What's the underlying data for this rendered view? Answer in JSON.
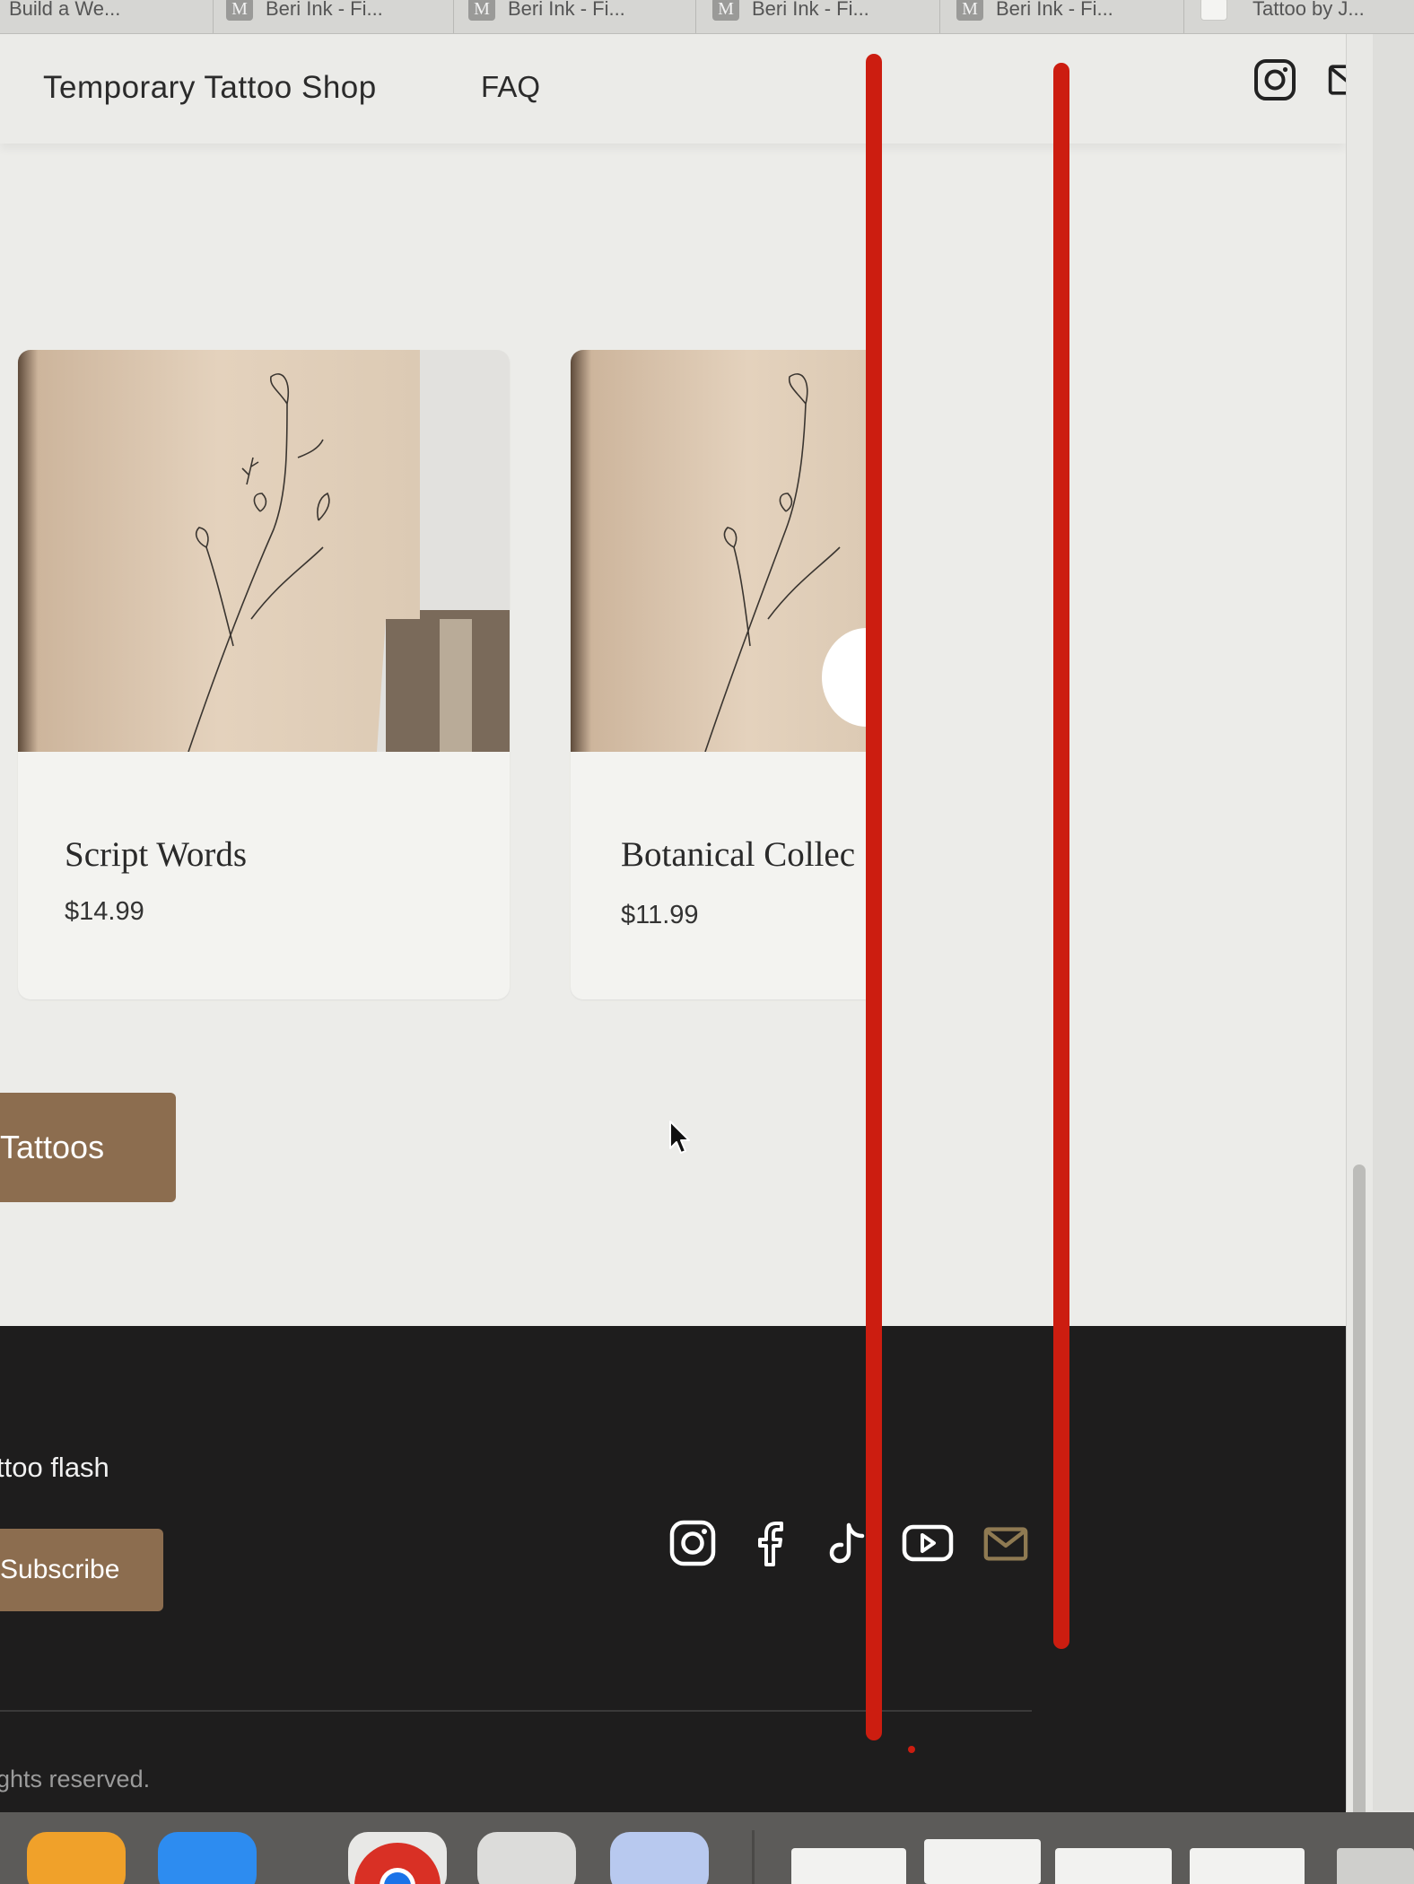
{
  "browser": {
    "tabs": [
      {
        "label": "Build a We...",
        "favicon": "globe-icon"
      },
      {
        "label": "Beri Ink - Fi...",
        "favicon": "M"
      },
      {
        "label": "Beri Ink - Fi...",
        "favicon": "M"
      },
      {
        "label": "Beri Ink - Fi...",
        "favicon": "M"
      },
      {
        "label": "Beri Ink - Fi...",
        "favicon": "M"
      },
      {
        "label": "Tattoo by J...",
        "favicon": "blank"
      }
    ]
  },
  "header": {
    "brand": "Temporary Tattoo Shop",
    "nav_faq": "FAQ",
    "icons": [
      "instagram-icon",
      "mail-icon"
    ]
  },
  "products": [
    {
      "title": "Script Words",
      "price": "$14.99"
    },
    {
      "title": "Botanical Collec",
      "price": "$11.99"
    }
  ],
  "cta": {
    "label": "Tattoos"
  },
  "footer": {
    "newsletter_text": "ttoo flash",
    "subscribe_label": "Subscribe",
    "social_icons": [
      "instagram-icon",
      "facebook-icon",
      "tiktok-icon",
      "youtube-icon",
      "mail-icon"
    ],
    "copyright": "ghts reserved."
  },
  "colors": {
    "accent": "#8c6d4f",
    "footer_bg": "#1e1d1d",
    "page_bg": "#ecece9",
    "marker_red": "#cc1d10",
    "mail_icon_gold": "#8f7a52"
  }
}
